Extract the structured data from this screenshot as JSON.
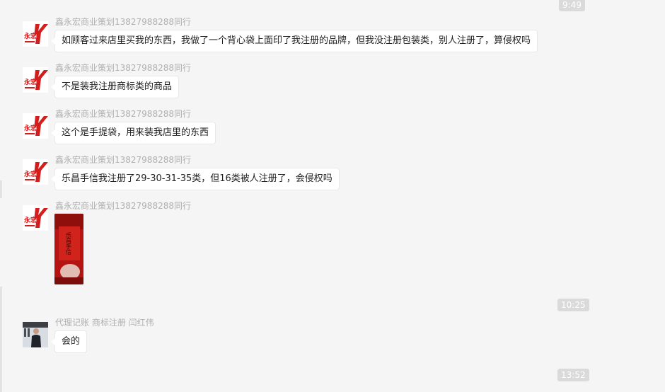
{
  "colors": {
    "chat_bg": "#f5f5f5",
    "bubble_bg": "#ffffff",
    "timestamp_bg": "#dadada",
    "brand_red": "#d41e1e"
  },
  "timestamps": [
    "9:49",
    "10:25",
    "13:52"
  ],
  "avatar_logo": {
    "chars": "永宏",
    "icon": "yongtong-logo-icon"
  },
  "messages": [
    {
      "sender": "鑫永宏商业策划13827988288同行",
      "text": "如顾客过来店里买我的东西，我做了一个背心袋上面印了我注册的品牌，但我没注册包装类，别人注册了，算侵权吗"
    },
    {
      "sender": "鑫永宏商业策划13827988288同行",
      "text": "不是装我注册商标类的商品"
    },
    {
      "sender": "鑫永宏商业策划13827988288同行",
      "text": "这个是手提袋，用来装我店里的东西"
    },
    {
      "sender": "鑫永宏商业策划13827988288同行",
      "text": "乐昌手信我注册了29-30-31-35类，但16类被人注册了，会侵权吗"
    },
    {
      "sender": "鑫永宏商业策划13827988288同行",
      "image_text": "乐昌手信"
    },
    {
      "sender": "代理记账 商标注册 闫红伟",
      "text": "会的"
    }
  ]
}
